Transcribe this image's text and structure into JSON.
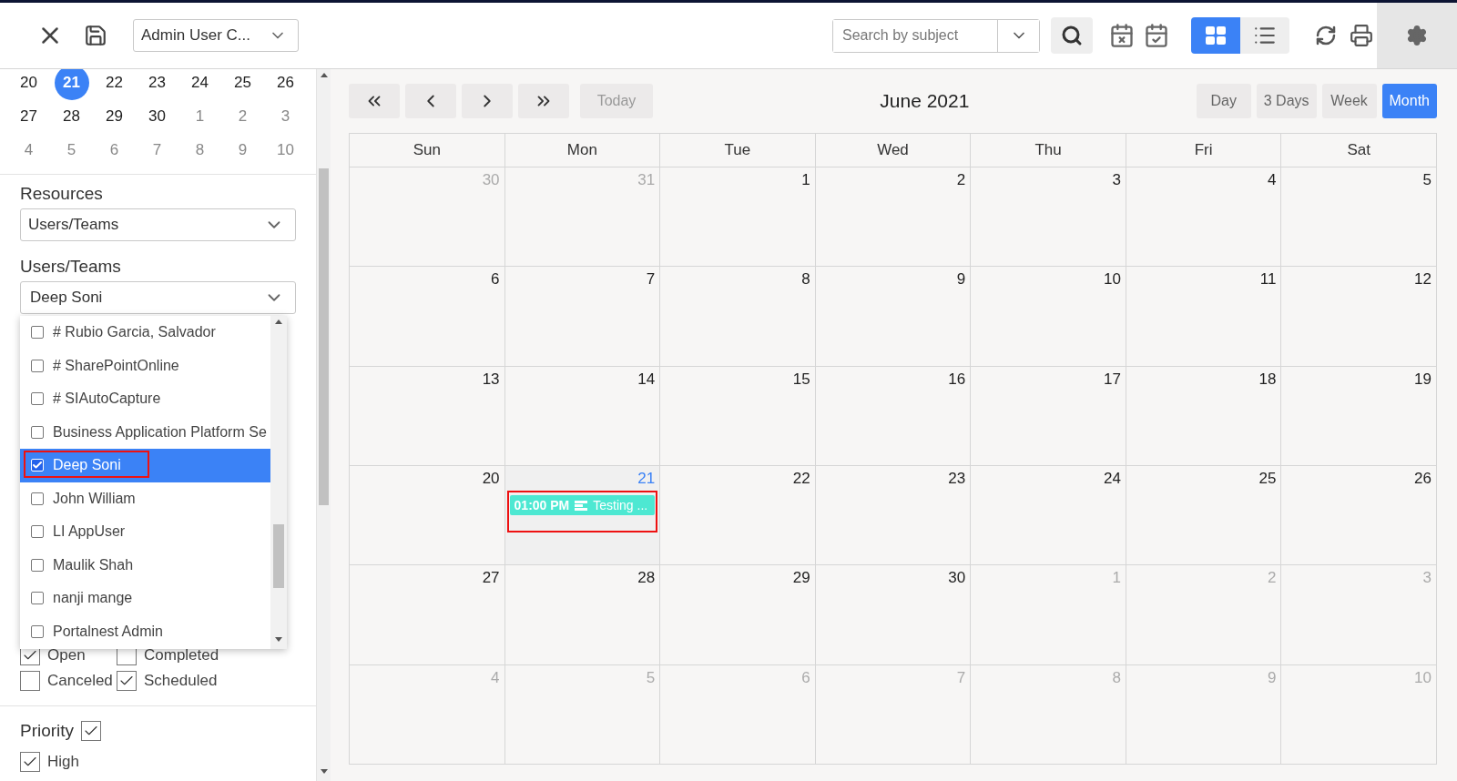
{
  "topbar": {
    "view_select": {
      "value": "Admin User C..."
    },
    "search": {
      "placeholder": "Search by subject"
    },
    "view_modes": [
      {
        "kind": "grid",
        "selected": true
      },
      {
        "kind": "list",
        "selected": false
      }
    ]
  },
  "sidebar": {
    "mini_calendar": {
      "weeks": [
        [
          {
            "day": "20",
            "selected": false,
            "other_month": false
          },
          {
            "day": "21",
            "selected": true,
            "other_month": false
          },
          {
            "day": "22",
            "selected": false,
            "other_month": false
          },
          {
            "day": "23",
            "selected": false,
            "other_month": false
          },
          {
            "day": "24",
            "selected": false,
            "other_month": false
          },
          {
            "day": "25",
            "selected": false,
            "other_month": false
          },
          {
            "day": "26",
            "selected": false,
            "other_month": false
          }
        ],
        [
          {
            "day": "27",
            "selected": false,
            "other_month": false
          },
          {
            "day": "28",
            "selected": false,
            "other_month": false
          },
          {
            "day": "29",
            "selected": false,
            "other_month": false
          },
          {
            "day": "30",
            "selected": false,
            "other_month": false
          },
          {
            "day": "1",
            "selected": false,
            "other_month": true
          },
          {
            "day": "2",
            "selected": false,
            "other_month": true
          },
          {
            "day": "3",
            "selected": false,
            "other_month": true
          }
        ],
        [
          {
            "day": "4",
            "selected": false,
            "other_month": true
          },
          {
            "day": "5",
            "selected": false,
            "other_month": true
          },
          {
            "day": "6",
            "selected": false,
            "other_month": true
          },
          {
            "day": "7",
            "selected": false,
            "other_month": true
          },
          {
            "day": "8",
            "selected": false,
            "other_month": true
          },
          {
            "day": "9",
            "selected": false,
            "other_month": true
          },
          {
            "day": "10",
            "selected": false,
            "other_month": true
          }
        ]
      ]
    },
    "resources": {
      "label": "Resources",
      "value": "Users/Teams"
    },
    "users_teams": {
      "label": "Users/Teams",
      "value": "Deep Soni",
      "options": [
        {
          "label": "# Rubio Garcia, Salvador",
          "checked": false,
          "selected": false,
          "highlighted": false
        },
        {
          "label": "# SharePointOnline",
          "checked": false,
          "selected": false,
          "highlighted": false
        },
        {
          "label": "# SIAutoCapture",
          "checked": false,
          "selected": false,
          "highlighted": false
        },
        {
          "label": "Business Application Platform Se",
          "checked": false,
          "selected": false,
          "highlighted": false
        },
        {
          "label": "Deep Soni",
          "checked": true,
          "selected": true,
          "highlighted": true
        },
        {
          "label": "John William",
          "checked": false,
          "selected": false,
          "highlighted": false
        },
        {
          "label": "LI AppUser",
          "checked": false,
          "selected": false,
          "highlighted": false
        },
        {
          "label": "Maulik Shah",
          "checked": false,
          "selected": false,
          "highlighted": false
        },
        {
          "label": "nanji mange",
          "checked": false,
          "selected": false,
          "highlighted": false
        },
        {
          "label": "Portalnest Admin",
          "checked": false,
          "selected": false,
          "highlighted": false
        }
      ]
    },
    "status": [
      {
        "label": "Open",
        "checked": true
      },
      {
        "label": "Completed",
        "checked": false
      },
      {
        "label": "Canceled",
        "checked": false
      },
      {
        "label": "Scheduled",
        "checked": true
      }
    ],
    "priority": {
      "label": "Priority",
      "checked": true,
      "items": [
        {
          "label": "High",
          "checked": true
        }
      ]
    }
  },
  "calendar": {
    "nav_buttons": [
      {
        "kind": "first"
      },
      {
        "kind": "prev"
      },
      {
        "kind": "next"
      },
      {
        "kind": "last"
      }
    ],
    "today": {
      "label": "Today",
      "disabled": true
    },
    "title": "June 2021",
    "views": [
      {
        "label": "Day",
        "selected": false
      },
      {
        "label": "3 Days",
        "selected": false
      },
      {
        "label": "Week",
        "selected": false
      },
      {
        "label": "Month",
        "selected": true
      }
    ],
    "weekdays": [
      "Sun",
      "Mon",
      "Tue",
      "Wed",
      "Thu",
      "Fri",
      "Sat"
    ],
    "weeks": [
      [
        {
          "day": "30",
          "other_month": true,
          "today": false,
          "highlighted": false
        },
        {
          "day": "31",
          "other_month": true,
          "today": false,
          "highlighted": false
        },
        {
          "day": "1",
          "other_month": false,
          "today": false,
          "highlighted": false
        },
        {
          "day": "2",
          "other_month": false,
          "today": false,
          "highlighted": false
        },
        {
          "day": "3",
          "other_month": false,
          "today": false,
          "highlighted": false
        },
        {
          "day": "4",
          "other_month": false,
          "today": false,
          "highlighted": false
        },
        {
          "day": "5",
          "other_month": false,
          "today": false,
          "highlighted": false
        }
      ],
      [
        {
          "day": "6",
          "other_month": false,
          "today": false,
          "highlighted": false
        },
        {
          "day": "7",
          "other_month": false,
          "today": false,
          "highlighted": false
        },
        {
          "day": "8",
          "other_month": false,
          "today": false,
          "highlighted": false
        },
        {
          "day": "9",
          "other_month": false,
          "today": false,
          "highlighted": false
        },
        {
          "day": "10",
          "other_month": false,
          "today": false,
          "highlighted": false
        },
        {
          "day": "11",
          "other_month": false,
          "today": false,
          "highlighted": false
        },
        {
          "day": "12",
          "other_month": false,
          "today": false,
          "highlighted": false
        }
      ],
      [
        {
          "day": "13",
          "other_month": false,
          "today": false,
          "highlighted": false
        },
        {
          "day": "14",
          "other_month": false,
          "today": false,
          "highlighted": false
        },
        {
          "day": "15",
          "other_month": false,
          "today": false,
          "highlighted": false
        },
        {
          "day": "16",
          "other_month": false,
          "today": false,
          "highlighted": false
        },
        {
          "day": "17",
          "other_month": false,
          "today": false,
          "highlighted": false
        },
        {
          "day": "18",
          "other_month": false,
          "today": false,
          "highlighted": false
        },
        {
          "day": "19",
          "other_month": false,
          "today": false,
          "highlighted": false
        }
      ],
      [
        {
          "day": "20",
          "other_month": false,
          "today": false,
          "highlighted": false
        },
        {
          "day": "21",
          "other_month": false,
          "today": true,
          "highlighted": true,
          "events": [
            {
              "time": "01:00 PM",
              "title": "Testing ...",
              "color": "#4de8d2"
            }
          ]
        },
        {
          "day": "22",
          "other_month": false,
          "today": false,
          "highlighted": false
        },
        {
          "day": "23",
          "other_month": false,
          "today": false,
          "highlighted": false
        },
        {
          "day": "24",
          "other_month": false,
          "today": false,
          "highlighted": false
        },
        {
          "day": "25",
          "other_month": false,
          "today": false,
          "highlighted": false
        },
        {
          "day": "26",
          "other_month": false,
          "today": false,
          "highlighted": false
        }
      ],
      [
        {
          "day": "27",
          "other_month": false,
          "today": false,
          "highlighted": false
        },
        {
          "day": "28",
          "other_month": false,
          "today": false,
          "highlighted": false
        },
        {
          "day": "29",
          "other_month": false,
          "today": false,
          "highlighted": false
        },
        {
          "day": "30",
          "other_month": false,
          "today": false,
          "highlighted": false
        },
        {
          "day": "1",
          "other_month": true,
          "today": false,
          "highlighted": false
        },
        {
          "day": "2",
          "other_month": true,
          "today": false,
          "highlighted": false
        },
        {
          "day": "3",
          "other_month": true,
          "today": false,
          "highlighted": false
        }
      ],
      [
        {
          "day": "4",
          "other_month": true,
          "today": false,
          "highlighted": false
        },
        {
          "day": "5",
          "other_month": true,
          "today": false,
          "highlighted": false
        },
        {
          "day": "6",
          "other_month": true,
          "today": false,
          "highlighted": false
        },
        {
          "day": "7",
          "other_month": true,
          "today": false,
          "highlighted": false
        },
        {
          "day": "8",
          "other_month": true,
          "today": false,
          "highlighted": false
        },
        {
          "day": "9",
          "other_month": true,
          "today": false,
          "highlighted": false
        },
        {
          "day": "10",
          "other_month": true,
          "today": false,
          "highlighted": false
        }
      ]
    ]
  }
}
